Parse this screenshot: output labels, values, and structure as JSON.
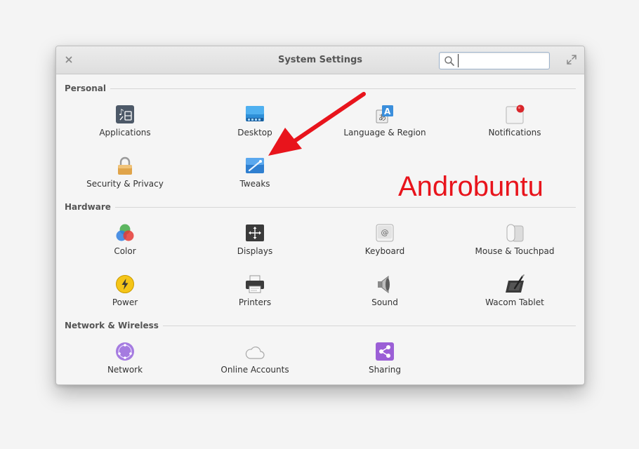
{
  "window": {
    "title": "System Settings",
    "search": {
      "value": "",
      "placeholder": ""
    }
  },
  "sections": [
    {
      "label": "Personal",
      "items": [
        {
          "label": "Applications",
          "icon": "applications-icon"
        },
        {
          "label": "Desktop",
          "icon": "desktop-icon"
        },
        {
          "label": "Language & Region",
          "icon": "language-icon"
        },
        {
          "label": "Notifications",
          "icon": "notifications-icon"
        },
        {
          "label": "Security & Privacy",
          "icon": "lock-icon"
        },
        {
          "label": "Tweaks",
          "icon": "tweaks-icon"
        }
      ]
    },
    {
      "label": "Hardware",
      "items": [
        {
          "label": "Color",
          "icon": "color-icon"
        },
        {
          "label": "Displays",
          "icon": "displays-icon"
        },
        {
          "label": "Keyboard",
          "icon": "keyboard-icon"
        },
        {
          "label": "Mouse & Touchpad",
          "icon": "mouse-icon"
        },
        {
          "label": "Power",
          "icon": "power-icon"
        },
        {
          "label": "Printers",
          "icon": "printer-icon"
        },
        {
          "label": "Sound",
          "icon": "speaker-icon"
        },
        {
          "label": "Wacom Tablet",
          "icon": "tablet-icon"
        }
      ]
    },
    {
      "label": "Network & Wireless",
      "items": [
        {
          "label": "Network",
          "icon": "network-icon"
        },
        {
          "label": "Online Accounts",
          "icon": "cloud-icon"
        },
        {
          "label": "Sharing",
          "icon": "share-icon"
        }
      ]
    }
  ],
  "watermark": "Androbuntu",
  "colors": {
    "watermark": "#e8141c",
    "arrow": "#e8141c",
    "search_border": "#9db3cc"
  }
}
